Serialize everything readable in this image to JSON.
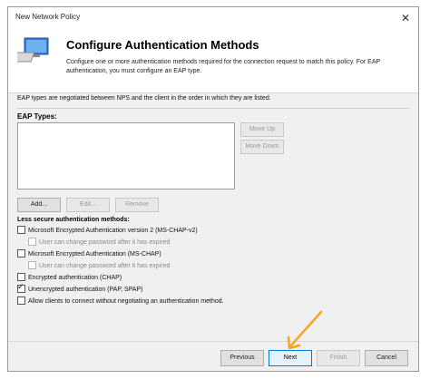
{
  "window": {
    "title": "New Network Policy",
    "close_glyph": "✕"
  },
  "header": {
    "title": "Configure Authentication Methods",
    "description": "Configure one or more authentication methods required for the connection request to match this policy. For EAP authentication, you must configure an EAP type."
  },
  "intro_text": "EAP types are negotiated between NPS and the client in the order in which they are listed.",
  "eap": {
    "label": "EAP Types:",
    "items": [],
    "move_up": "Move Up",
    "move_down": "Move Down",
    "add": "Add...",
    "edit": "Edit...",
    "remove": "Remove"
  },
  "less_secure": {
    "label": "Less secure authentication methods:",
    "options": [
      {
        "label": "Microsoft Encrypted Authentication version 2 (MS-CHAP-v2)",
        "checked": false
      },
      {
        "label": "User can change password after it has expired",
        "checked": false,
        "disabled": true
      },
      {
        "label": "Microsoft Encrypted Authentication (MS-CHAP)",
        "checked": false
      },
      {
        "label": "User can change password after it has expired",
        "checked": false,
        "disabled": true
      },
      {
        "label": "Encrypted authentication (CHAP)",
        "checked": false
      },
      {
        "label": "Unencrypted authentication (PAP, SPAP)",
        "checked": true
      },
      {
        "label": "Allow clients to connect without negotiating an authentication method.",
        "checked": false
      }
    ]
  },
  "footer": {
    "previous": "Previous",
    "next": "Next",
    "finish": "Finish",
    "cancel": "Cancel"
  },
  "colors": {
    "accent": "#0078d7",
    "arrow": "#f5a623"
  }
}
